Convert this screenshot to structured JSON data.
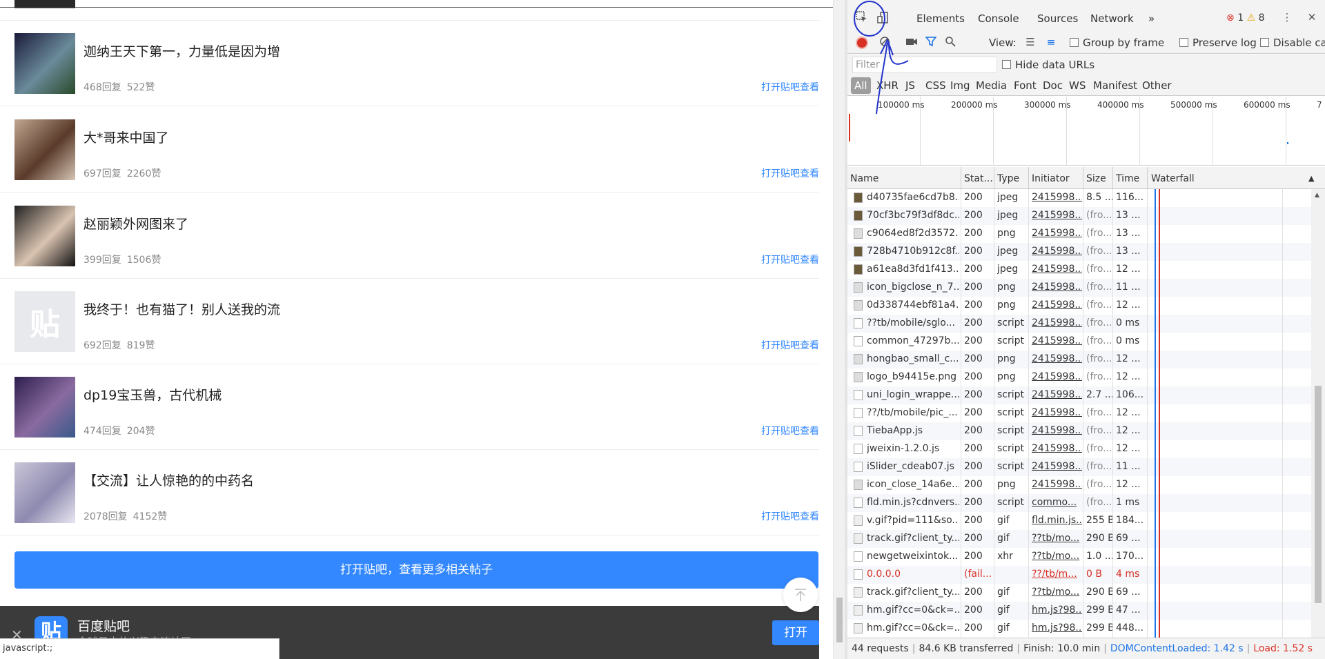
{
  "page": {
    "posts": [
      {
        "title": "迦纳王天下第一，力量低是因为增",
        "replies": "468回复",
        "likes": "522赞",
        "link": "打开贴吧查看"
      },
      {
        "title": "大*哥来中国了",
        "replies": "697回复",
        "likes": "2260赞",
        "link": "打开贴吧查看"
      },
      {
        "title": "赵丽颖外网图来了",
        "replies": "399回复",
        "likes": "1506赞",
        "link": "打开贴吧查看"
      },
      {
        "title": "我终于！也有猫了！别人送我的流",
        "replies": "692回复",
        "likes": "819赞",
        "link": "打开贴吧查看",
        "placeholder_glyph": "贴"
      },
      {
        "title": "dp19宝玉兽，古代机械",
        "replies": "474回复",
        "likes": "204赞",
        "link": "打开贴吧查看"
      },
      {
        "title": "【交流】让人惊艳的的中药名",
        "replies": "2078回复",
        "likes": "4152赞",
        "link": "打开贴吧查看"
      }
    ],
    "more_button": "打开贴吧，查看更多相关帖子",
    "banner": {
      "close": "✕",
      "logo_glyph": "贴",
      "app_name": "百度贴吧",
      "slogan": "全球最大的兴趣交流社区",
      "open_button": "打开"
    },
    "status_url": "javascript:;"
  },
  "devtools": {
    "tabs": [
      "Elements",
      "Console",
      "Sources",
      "Network",
      "»"
    ],
    "active_tab": "Network",
    "errors": "1",
    "warnings": "8",
    "toolbar": {
      "view_label": "View:",
      "group_by_frame": "Group by frame",
      "preserve_log": "Preserve log",
      "disable_cache": "Disable cac"
    },
    "filter_placeholder": "Filter",
    "hide_data_urls": "Hide data URLs",
    "types": [
      "All",
      "XHR",
      "JS",
      "CSS",
      "Img",
      "Media",
      "Font",
      "Doc",
      "WS",
      "Manifest",
      "Other"
    ],
    "overview_ticks": [
      "100000 ms",
      "200000 ms",
      "300000 ms",
      "400000 ms",
      "500000 ms",
      "600000 ms",
      "7"
    ],
    "columns": [
      "Name",
      "Stat...",
      "Type",
      "Initiator",
      "Size",
      "Time",
      "Waterfall"
    ],
    "sort_indicator": "▲",
    "rows": [
      {
        "name": "d40735fae6cd7b8...",
        "status": "200",
        "type": "jpeg",
        "initiator": "2415998...",
        "size": "8.5 ...",
        "time": "116..."
      },
      {
        "name": "70cf3bc79f3df8dc...",
        "status": "200",
        "type": "jpeg",
        "initiator": "2415998...",
        "size": "(fro...",
        "time": "13 ..."
      },
      {
        "name": "c9064ed8f2d3572...",
        "status": "200",
        "type": "png",
        "initiator": "2415998...",
        "size": "(fro...",
        "time": "13 ..."
      },
      {
        "name": "728b4710b912c8f...",
        "status": "200",
        "type": "jpeg",
        "initiator": "2415998...",
        "size": "(fro...",
        "time": "13 ..."
      },
      {
        "name": "a61ea8d3fd1f413...",
        "status": "200",
        "type": "jpeg",
        "initiator": "2415998...",
        "size": "(fro...",
        "time": "12 ..."
      },
      {
        "name": "icon_bigclose_n_7...",
        "status": "200",
        "type": "png",
        "initiator": "2415998...",
        "size": "(fro...",
        "time": "11 ..."
      },
      {
        "name": "0d338744ebf81a4...",
        "status": "200",
        "type": "png",
        "initiator": "2415998...",
        "size": "(fro...",
        "time": "12 ..."
      },
      {
        "name": "??tb/mobile/sglo...",
        "status": "200",
        "type": "script",
        "initiator": "2415998...",
        "size": "(fro...",
        "time": "0 ms"
      },
      {
        "name": "common_47297b...",
        "status": "200",
        "type": "script",
        "initiator": "2415998...",
        "size": "(fro...",
        "time": "0 ms"
      },
      {
        "name": "hongbao_small_c...",
        "status": "200",
        "type": "png",
        "initiator": "2415998...",
        "size": "(fro...",
        "time": "12 ..."
      },
      {
        "name": "logo_b94415e.png",
        "status": "200",
        "type": "png",
        "initiator": "2415998...",
        "size": "(fro...",
        "time": "12 ..."
      },
      {
        "name": "uni_login_wrappe...",
        "status": "200",
        "type": "script",
        "initiator": "2415998...",
        "size": "2.7 ...",
        "time": "106..."
      },
      {
        "name": "??/tb/mobile/pic_...",
        "status": "200",
        "type": "script",
        "initiator": "2415998...",
        "size": "(fro...",
        "time": "12 ..."
      },
      {
        "name": "TiebaApp.js",
        "status": "200",
        "type": "script",
        "initiator": "2415998...",
        "size": "(fro...",
        "time": "12 ..."
      },
      {
        "name": "jweixin-1.2.0.js",
        "status": "200",
        "type": "script",
        "initiator": "2415998...",
        "size": "(fro...",
        "time": "12 ..."
      },
      {
        "name": "iSlider_cdeab07.js",
        "status": "200",
        "type": "script",
        "initiator": "2415998...",
        "size": "(fro...",
        "time": "11 ..."
      },
      {
        "name": "icon_close_14a6e...",
        "status": "200",
        "type": "png",
        "initiator": "2415998...",
        "size": "(fro...",
        "time": "12 ..."
      },
      {
        "name": "fld.min.js?cdnvers...",
        "status": "200",
        "type": "script",
        "initiator": "commo...",
        "size": "(fro...",
        "time": "1 ms"
      },
      {
        "name": "v.gif?pid=111&so...",
        "status": "200",
        "type": "gif",
        "initiator": "fld.min.js...",
        "size": "255 B",
        "time": "184..."
      },
      {
        "name": "track.gif?client_ty...",
        "status": "200",
        "type": "gif",
        "initiator": "??tb/mo...",
        "size": "290 B",
        "time": "69 ..."
      },
      {
        "name": "newgetweixintok...",
        "status": "200",
        "type": "xhr",
        "initiator": "??tb/mo...",
        "size": "1.0 ...",
        "time": "170..."
      },
      {
        "name": "0.0.0.0",
        "status": "(fail...",
        "type": "",
        "initiator": "??/tb/m...",
        "size": "0 B",
        "time": "4 ms",
        "failed": true
      },
      {
        "name": "track.gif?client_ty...",
        "status": "200",
        "type": "gif",
        "initiator": "??tb/mo...",
        "size": "290 B",
        "time": "69 ..."
      },
      {
        "name": "hm.gif?cc=0&ck=...",
        "status": "200",
        "type": "gif",
        "initiator": "hm.js?98...",
        "size": "299 B",
        "time": "47 ..."
      },
      {
        "name": "hm.gif?cc=0&ck=...",
        "status": "200",
        "type": "gif",
        "initiator": "hm.js?98...",
        "size": "299 B",
        "time": "448..."
      }
    ],
    "status": {
      "requests": "44 requests",
      "transferred": "84.6 KB transferred",
      "finish": "Finish: 10.0 min",
      "dom_loaded": "DOMContentLoaded: 1.42 s",
      "load": "Load: 1.52 s"
    }
  }
}
